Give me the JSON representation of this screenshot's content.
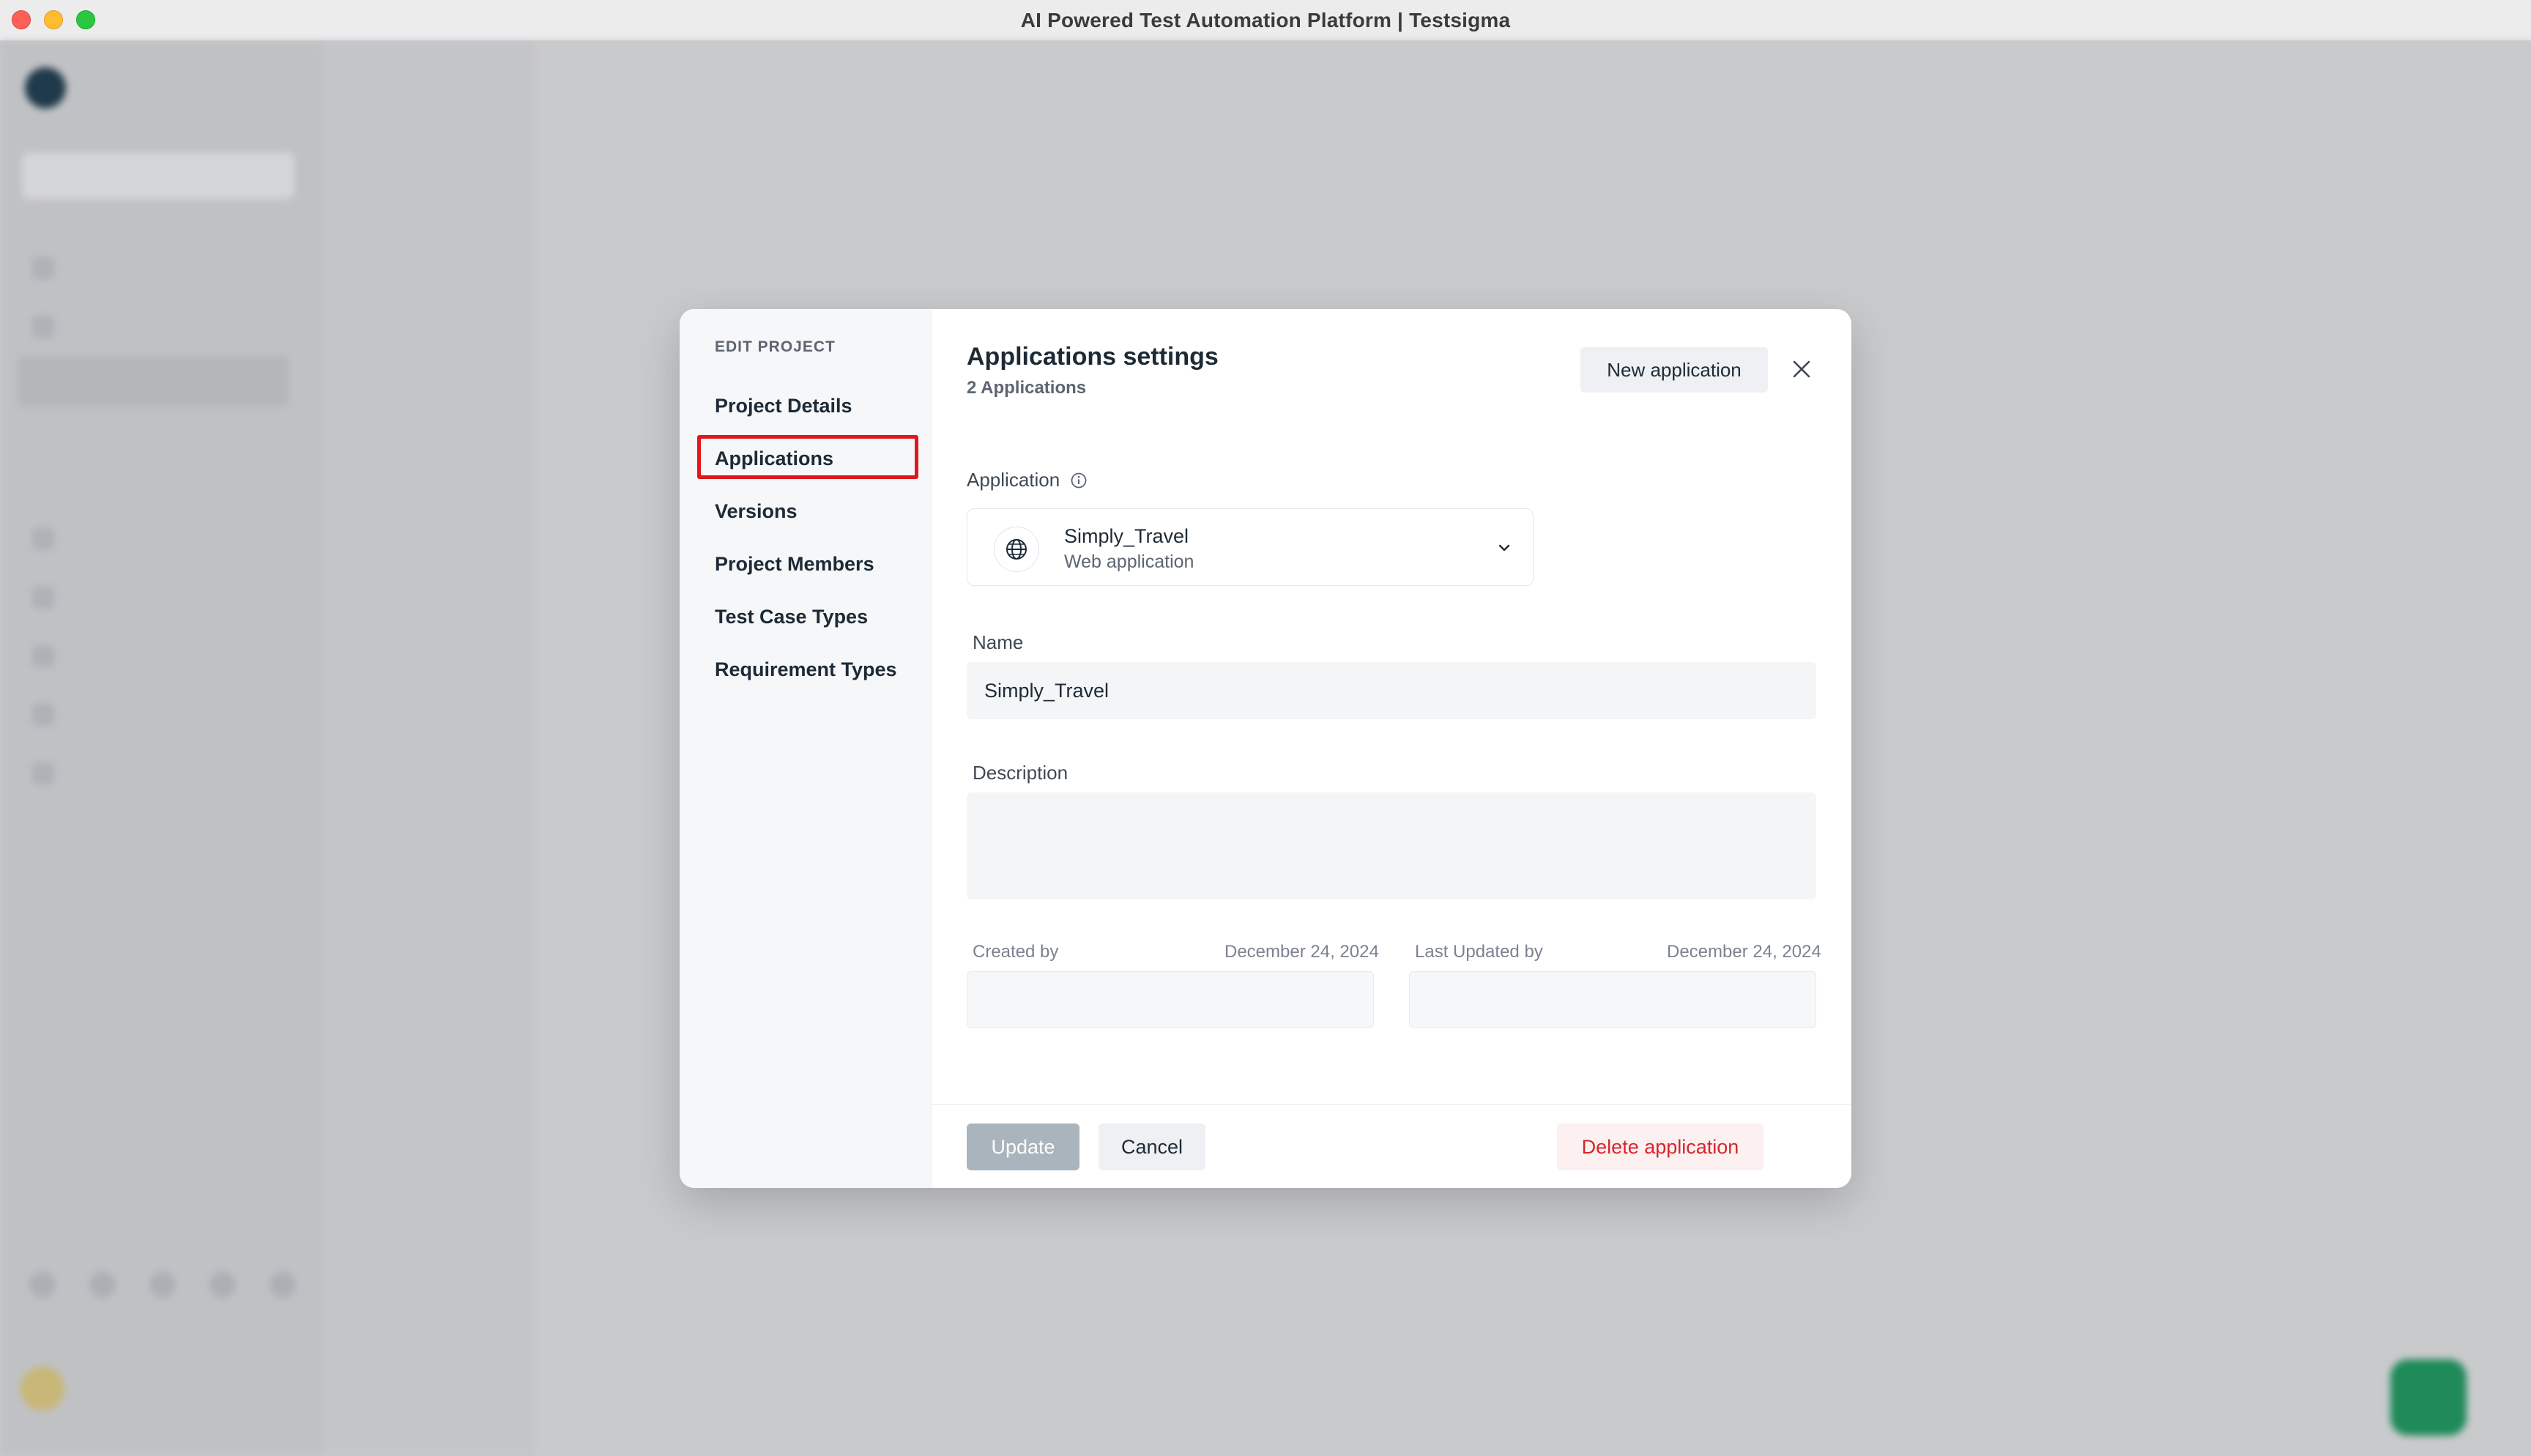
{
  "window": {
    "title": "AI Powered Test Automation Platform | Testsigma"
  },
  "modal": {
    "sidebar": {
      "heading": "EDIT PROJECT",
      "items": [
        {
          "label": "Project Details"
        },
        {
          "label": "Applications",
          "selected": true
        },
        {
          "label": "Versions"
        },
        {
          "label": "Project Members"
        },
        {
          "label": "Test Case Types"
        },
        {
          "label": "Requirement Types"
        }
      ]
    },
    "title": "Applications settings",
    "subtitle": "2 Applications",
    "new_application_label": "New application",
    "application_label": "Application",
    "selected_application": {
      "name": "Simply_Travel",
      "type": "Web application"
    },
    "name_label": "Name",
    "name_value": "Simply_Travel",
    "description_label": "Description",
    "description_value": "",
    "created_by_label": "Created by",
    "created_date": "December 24, 2024",
    "updated_by_label": "Last Updated by",
    "updated_date": "December 24, 2024",
    "update_label": "Update",
    "cancel_label": "Cancel",
    "delete_label": "Delete application"
  },
  "colors": {
    "highlight": "#e0171d",
    "delete_text": "#d6262b",
    "update_disabled_bg": "#a9b4bc"
  }
}
